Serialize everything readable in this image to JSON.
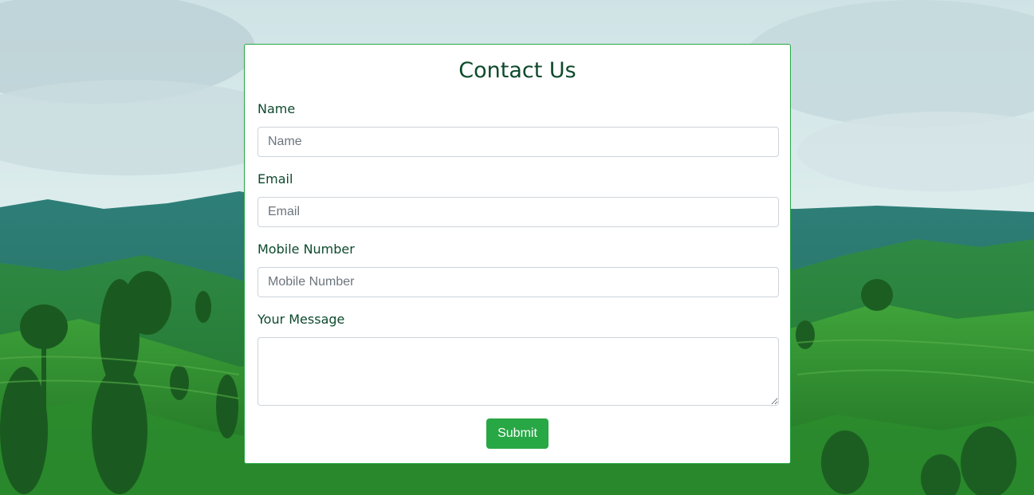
{
  "form": {
    "title": "Contact Us",
    "fields": {
      "name": {
        "label": "Name",
        "placeholder": "Name",
        "value": ""
      },
      "email": {
        "label": "Email",
        "placeholder": "Email",
        "value": ""
      },
      "mobile": {
        "label": "Mobile Number",
        "placeholder": "Mobile Number",
        "value": ""
      },
      "message": {
        "label": "Your Message",
        "placeholder": "",
        "value": ""
      }
    },
    "submit_label": "Submit"
  },
  "colors": {
    "accent": "#28a745",
    "heading": "#0d4a2c",
    "input_border": "#ced4da"
  }
}
